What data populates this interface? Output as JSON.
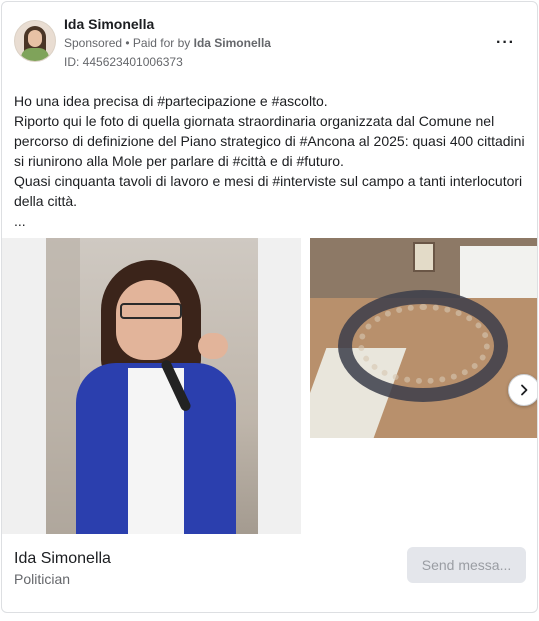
{
  "post": {
    "author": "Ida Simonella",
    "sponsored_label": "Sponsored",
    "separator": " • ",
    "paid_for_prefix": "Paid for by ",
    "paid_for_name": "Ida Simonella",
    "ad_id": "ID: 445623401006373",
    "more_icon": "···"
  },
  "body": {
    "lines": [
      "Ho una idea precisa di #partecipazione e #ascolto.",
      "Riporto qui le foto di quella giornata straordinaria organizzata dal Comune nel percorso di definizione del Piano strategico di #Ancona al 2025: quasi 400 cittadini si riunirono alla Mole per parlare di #città e di #futuro.",
      "Quasi cinquanta tavoli di lavoro e mesi di #interviste sul campo a tanti interlocutori della città.",
      "..."
    ]
  },
  "carousel": {
    "next_icon": "chevron-right-icon"
  },
  "footer": {
    "name": "Ida Simonella",
    "role": "Politician",
    "send_button": "Send messa..."
  },
  "colors": {
    "primary_text": "#1c1e21",
    "secondary_text": "#65676b",
    "button_bg": "#e4e6eb",
    "button_text": "#9a9da3"
  }
}
